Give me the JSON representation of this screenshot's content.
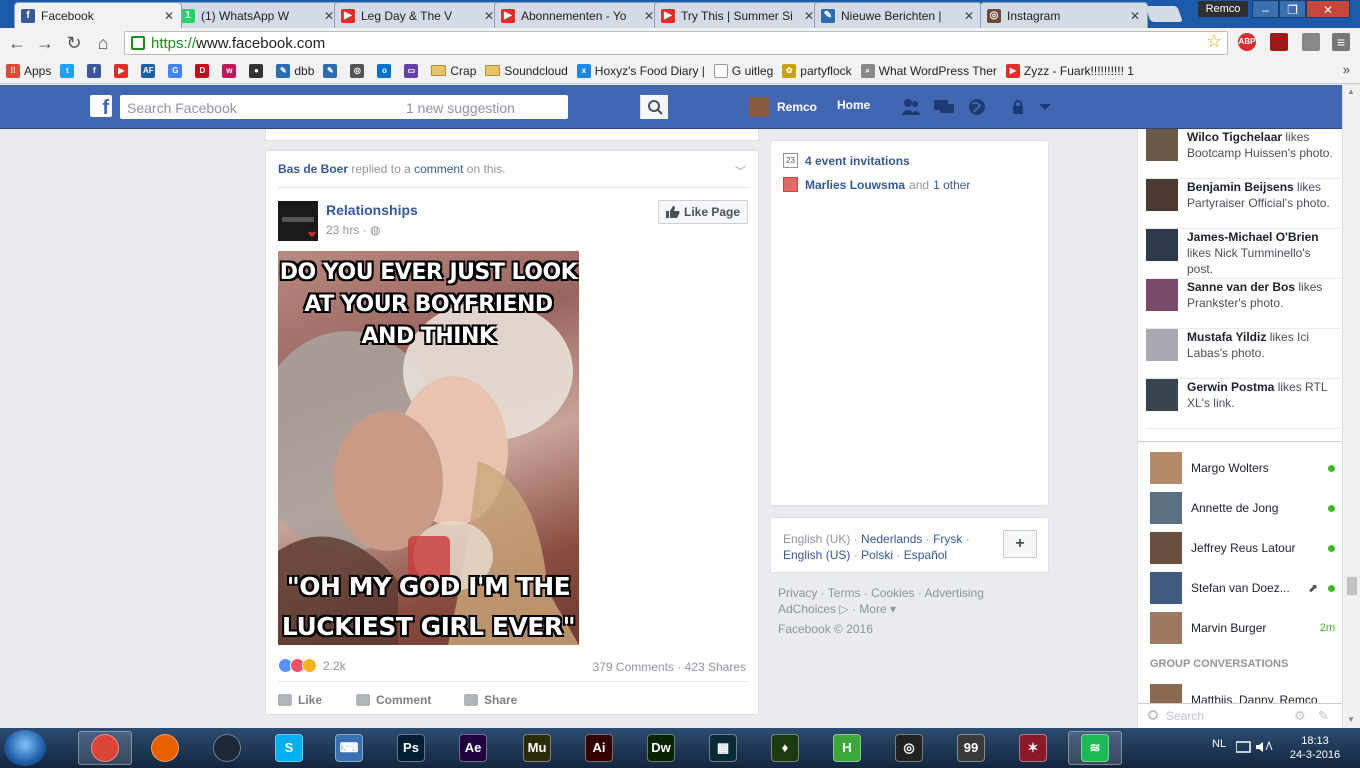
{
  "browser": {
    "tabs": [
      {
        "label": "Facebook",
        "icon": "facebook-icon",
        "color": "#3b5998",
        "glyph": "f",
        "active": true
      },
      {
        "label": "(1) WhatsApp W",
        "icon": "whatsapp-icon",
        "color": "#25d366",
        "glyph": "1",
        "active": false
      },
      {
        "label": "Leg Day & The V",
        "icon": "youtube-icon",
        "color": "#e52d27",
        "glyph": "▶",
        "active": false
      },
      {
        "label": "Abonnementen - Yo",
        "icon": "youtube-icon",
        "color": "#e52d27",
        "glyph": "▶",
        "active": false
      },
      {
        "label": "Try This | Summer Si",
        "icon": "youtube-icon",
        "color": "#e52d27",
        "glyph": "▶",
        "active": false
      },
      {
        "label": "Nieuwe Berichten | ",
        "icon": "forum-icon",
        "color": "#2b6db0",
        "glyph": "✎",
        "active": false
      },
      {
        "label": "Instagram",
        "icon": "instagram-icon",
        "color": "#6b4a3a",
        "glyph": "◎",
        "active": false
      }
    ],
    "user_badge": "Remco",
    "url_scheme": "https://",
    "url_host": "www.facebook.com",
    "bookmarks": [
      {
        "label": "Apps",
        "kind": "apps",
        "color": "#e04a3a"
      },
      {
        "label": "",
        "kind": "icon",
        "color": "#1da1f2",
        "glyph": "t"
      },
      {
        "label": "",
        "kind": "icon",
        "color": "#3b5998",
        "glyph": "f"
      },
      {
        "label": "",
        "kind": "icon",
        "color": "#e52d27",
        "glyph": "▶"
      },
      {
        "label": "",
        "kind": "icon",
        "color": "#1f5fa8",
        "glyph": "AF"
      },
      {
        "label": "",
        "kind": "icon",
        "color": "#4285f4",
        "glyph": "G"
      },
      {
        "label": "",
        "kind": "icon",
        "color": "#d0021b",
        "glyph": "D"
      },
      {
        "label": "",
        "kind": "icon",
        "color": "#c2185b",
        "glyph": "w"
      },
      {
        "label": "",
        "kind": "icon",
        "color": "#333333",
        "glyph": "●"
      },
      {
        "label": "dbb",
        "kind": "icon",
        "color": "#2b6db0",
        "glyph": "✎"
      },
      {
        "label": "",
        "kind": "icon",
        "color": "#2b6db0",
        "glyph": "✎"
      },
      {
        "label": "",
        "kind": "icon",
        "color": "#555555",
        "glyph": "◎"
      },
      {
        "label": "",
        "kind": "icon",
        "color": "#0072c6",
        "glyph": "o"
      },
      {
        "label": "",
        "kind": "icon",
        "color": "#6441a4",
        "glyph": "▭"
      },
      {
        "label": "Crap",
        "kind": "folder"
      },
      {
        "label": "Soundcloud",
        "kind": "folder"
      },
      {
        "label": "Hoxyz's Food Diary | ",
        "kind": "icon",
        "color": "#1e88e5",
        "glyph": "x"
      },
      {
        "label": "G uitleg",
        "kind": "page"
      },
      {
        "label": "partyflock",
        "kind": "icon",
        "color": "#c8a200",
        "glyph": "✿"
      },
      {
        "label": "What WordPress Ther",
        "kind": "icon",
        "color": "#888888",
        "glyph": "⌕"
      },
      {
        "label": "Zyzz - Fuark!!!!!!!!!! 1",
        "kind": "icon",
        "color": "#e52d27",
        "glyph": "▶"
      }
    ]
  },
  "fb": {
    "search_placeholder": "Search Facebook",
    "search_suggestion": "1 new suggestion",
    "profile_name": "Remco",
    "home_label": "Home",
    "story": {
      "actor": "Bas de Boer",
      "verb": "replied to a",
      "object": "comment",
      "suffix": "on this.",
      "page_name": "Relationships",
      "time": "23 hrs · ",
      "like_page_label": "Like Page",
      "meme_top": [
        "DO YOU EVER JUST LOOK",
        "AT YOUR BOYFRIEND",
        "AND THINK"
      ],
      "meme_bottom": [
        "\"OH MY GOD I'M THE",
        "LUCKIEST GIRL EVER\""
      ],
      "reaction_count": "2.2k",
      "comments": "379 Comments",
      "shares": "423 Shares",
      "actions": {
        "like": "Like",
        "comment": "Comment",
        "share": "Share"
      }
    },
    "events": {
      "invitations": "4 event invitations",
      "birthday_name": "Marlies Louwsma",
      "birthday_and": "and",
      "birthday_other": "1 other",
      "calendar_day": "23"
    },
    "languages": {
      "line1": [
        "English (UK)",
        "Nederlands",
        "Frysk"
      ],
      "line2": [
        "English (US)",
        "Polski",
        "Español"
      ],
      "plus": "+"
    },
    "footer_links": [
      "Privacy",
      "Terms",
      "Cookies",
      "Advertising",
      "AdChoices",
      "More"
    ],
    "copyright": "Facebook © 2016",
    "ticker": [
      {
        "name": "Wilco Tigchelaar",
        "text": " likes Bootcamp Huissen's photo.",
        "color": "#6b5a48"
      },
      {
        "name": "Benjamin Beijsens",
        "text": " likes Partyraiser Official's photo.",
        "color": "#4a3a30"
      },
      {
        "name": "James-Michael O'Brien",
        "text": " likes Nick Tumminello's post.",
        "color": "#2f3a48"
      },
      {
        "name": "Sanne van der Bos",
        "text": " likes Prankster's photo.",
        "color": "#7a4a6a"
      },
      {
        "name": "Mustafa Yildiz",
        "text": " likes Ici Labas's photo.",
        "color": "#a8a8b0"
      },
      {
        "name": "Gerwin Postma",
        "text": " likes RTL XL's link.",
        "color": "#3a4450"
      }
    ],
    "chat": [
      {
        "name": "Margo Wolters",
        "status": "online",
        "meta": "",
        "color": "#b48a6a"
      },
      {
        "name": "Annette de Jong",
        "status": "online",
        "meta": "",
        "color": "#5a7080"
      },
      {
        "name": "Jeffrey Reus Latour",
        "status": "online",
        "meta": "",
        "color": "#6a5040"
      },
      {
        "name": "Stefan van Doez...",
        "status": "online",
        "meta": "",
        "color": "#405a80"
      },
      {
        "name": "Marvin Burger",
        "status": "idle",
        "meta": "2m",
        "color": "#a07860"
      }
    ],
    "group_heading": "GROUP CONVERSATIONS",
    "group_first": "Matthijs, Danny, Remco",
    "chat_search_placeholder": "Search"
  },
  "taskbar": {
    "apps": [
      {
        "name": "chrome-icon",
        "label": "",
        "color": "#db4437"
      },
      {
        "name": "firefox-icon",
        "label": "",
        "color": "#e66000"
      },
      {
        "name": "steam-icon",
        "label": "",
        "color": "#1b2838"
      },
      {
        "name": "skype-icon",
        "label": "S",
        "color": "#00aff0"
      },
      {
        "name": "keyboard-icon",
        "label": "⌨",
        "color": "#3a6fb0"
      },
      {
        "name": "photoshop-icon",
        "label": "Ps",
        "color": "#001e36"
      },
      {
        "name": "after-effects-icon",
        "label": "Ae",
        "color": "#1f0040"
      },
      {
        "name": "muse-icon",
        "label": "Mu",
        "color": "#2b2b0a"
      },
      {
        "name": "illustrator-icon",
        "label": "Ai",
        "color": "#330000"
      },
      {
        "name": "dreamweaver-icon",
        "label": "Dw",
        "color": "#072401"
      },
      {
        "name": "video-editor-icon",
        "label": "▦",
        "color": "#0a2a3a"
      },
      {
        "name": "razer-icon",
        "label": "♦",
        "color": "#1a3a10"
      },
      {
        "name": "hitfilm-icon",
        "label": "H",
        "color": "#3aa83a"
      },
      {
        "name": "steering-wheel-icon",
        "label": "◎",
        "color": "#222222"
      },
      {
        "name": "monitor-icon",
        "label": "99",
        "color": "#3a3a3a"
      },
      {
        "name": "game-icon",
        "label": "✶",
        "color": "#8a1a2a"
      },
      {
        "name": "spotify-icon",
        "label": "≋",
        "color": "#1db954"
      }
    ],
    "lang": "NL",
    "time": "18:13",
    "date": "24-3-2016"
  }
}
